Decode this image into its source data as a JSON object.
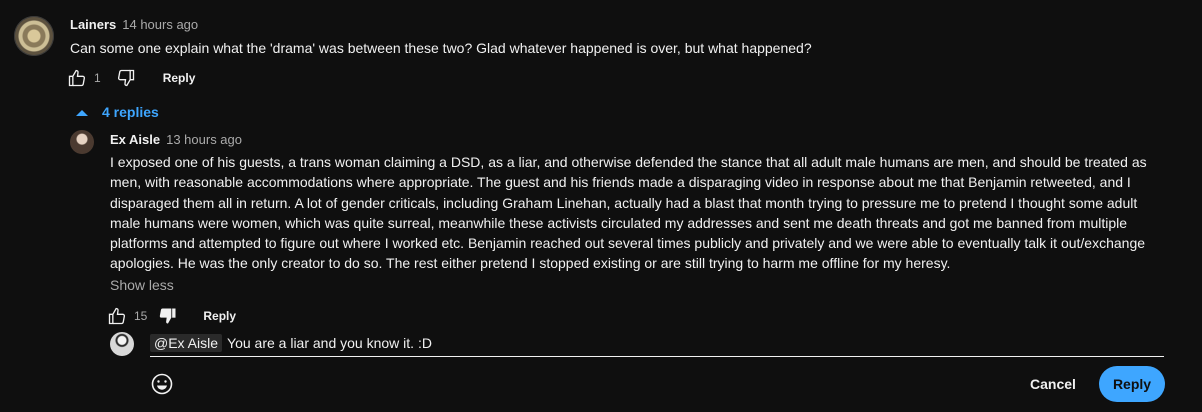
{
  "comment": {
    "author": "Lainers",
    "time": "14 hours ago",
    "text": "Can some one explain what the 'drama' was between these two? Glad whatever happened is over, but what happened?",
    "like_count": "1",
    "reply_label": "Reply",
    "replies_label": "4 replies"
  },
  "reply": {
    "author": "Ex Aisle",
    "time": "13 hours ago",
    "lines": [
      "I exposed one of his guests, a trans woman claiming a DSD, as a liar, and otherwise defended the stance that all adult male humans are men, and should be treated as",
      "men, with reasonable accommodations where appropriate.   The guest and his friends made a disparaging video in response about me that Benjamin retweeted, and I",
      "disparaged them all in return.   A lot of gender criticals, including Graham Linehan, actually had a blast that month trying to pressure me to pretend I thought some adult",
      "male humans were women, which was quite surreal, meanwhile these activists circulated my addresses and sent me death threats and got me banned from multiple",
      "platforms and attempted to figure out where I worked etc.  Benjamin reached out several times publicly and privately and we were able to eventually talk it out/exchange",
      "apologies.  He was the only creator to do so.  The rest either pretend I stopped existing or are still trying to harm me offline for my heresy."
    ],
    "show_less": "Show less",
    "like_count": "15",
    "reply_label": "Reply"
  },
  "reply_input": {
    "mention": "@Ex Aisle",
    "text": "You are a liar and you know it. :D"
  },
  "actions": {
    "cancel": "Cancel",
    "reply": "Reply"
  },
  "colors": {
    "background": "#0f0f0f",
    "accent": "#3ea6ff",
    "secondary_text": "#aaaaaa"
  },
  "icons": [
    "thumbs-up-icon",
    "thumbs-down-icon",
    "chevron-up-icon",
    "emoji-icon"
  ]
}
